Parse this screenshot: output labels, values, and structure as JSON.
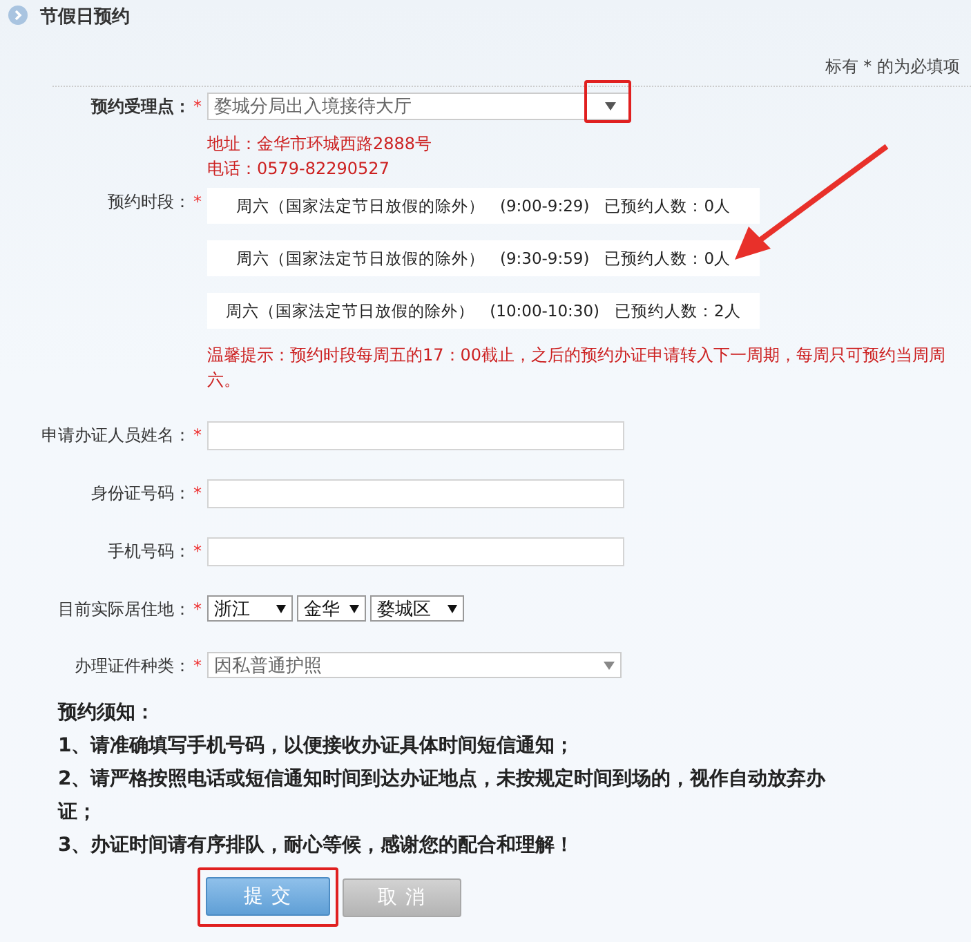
{
  "header": {
    "title": "节假日预约"
  },
  "required_note": "标有 * 的为必填项",
  "site": {
    "label": "预约受理点：",
    "required": "*",
    "value": "婺城分局出入境接待大厅",
    "address": "地址：金华市环城西路2888号",
    "phone": "电话：0579-82290527"
  },
  "slots": {
    "label": "预约时段：",
    "required": "*",
    "items": [
      {
        "day": "周六（国家法定节日放假的除外）",
        "time": "(9:00-9:29)",
        "booked": "已预约人数：0人"
      },
      {
        "day": "周六（国家法定节日放假的除外）",
        "time": "(9:30-9:59)",
        "booked": "已预约人数：0人"
      },
      {
        "day": "周六（国家法定节日放假的除外）",
        "time": "(10:00-10:30)",
        "booked": "已预约人数：2人"
      }
    ],
    "tip": "温馨提示：预约时段每周五的17：00截止，之后的预约办证申请转入下一周期，每周只可预约当周周六。"
  },
  "fields": [
    {
      "kind": "text",
      "label": "申请办证人员姓名：",
      "required": "*"
    },
    {
      "kind": "text",
      "label": "身份证号码：",
      "required": "*"
    },
    {
      "kind": "text",
      "label": "手机号码：",
      "required": "*"
    },
    {
      "kind": "selects",
      "label": "目前实际居住地：",
      "required": "*",
      "options": [
        "浙江",
        "金华",
        "婺城区"
      ]
    },
    {
      "kind": "select",
      "label": "办理证件种类：",
      "required": "*",
      "value": "因私普通护照"
    }
  ],
  "notice": {
    "title": "预约须知：",
    "items": [
      "1、请准确填写手机号码，以便接收办证具体时间短信通知；",
      "2、请严格按照电话或短信通知时间到达办证地点，未按规定时间到场的，视作自动放弃办证；",
      "3、办证时间请有序排队，耐心等候，感谢您的配合和理解！"
    ]
  },
  "buttons": [
    {
      "kind": "primary",
      "label": "提 交"
    },
    {
      "kind": "secondary",
      "label": "取 消"
    }
  ]
}
